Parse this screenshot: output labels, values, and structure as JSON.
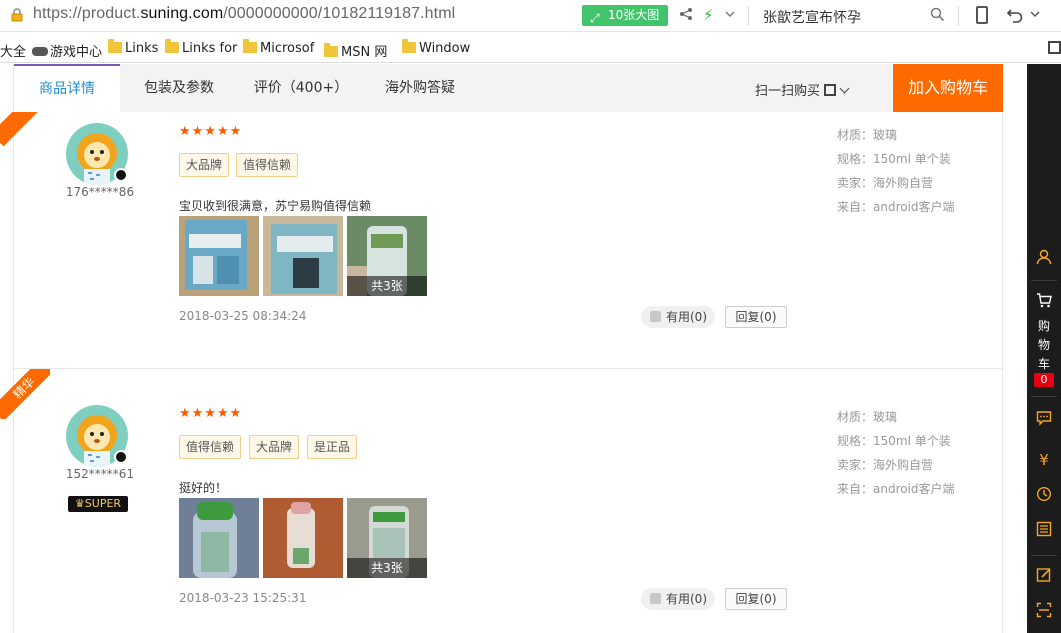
{
  "browser": {
    "url_prefix": "https://product.",
    "url_domain": "suning.com",
    "url_suffix": "/0000000000/10182119187.html",
    "image_button": "10张大图",
    "search_text": "张歆艺宣布怀孕"
  },
  "bookmarks": [
    {
      "label": "大全",
      "icon": "none"
    },
    {
      "label": "游戏中心",
      "icon": "gamepad-icon"
    },
    {
      "label": "Links",
      "icon": "folder-icon"
    },
    {
      "label": "Links for",
      "icon": "folder-icon"
    },
    {
      "label": "Microsof",
      "icon": "folder-icon"
    },
    {
      "label": "MSN 网",
      "icon": "folder-icon"
    },
    {
      "label": "Window",
      "icon": "folder-icon"
    }
  ],
  "tabs": {
    "details": "商品详情",
    "params": "包装及参数",
    "reviews": "评价（400+）",
    "overseas": "海外购答疑",
    "scan": "扫一扫购买",
    "add_cart": "加入购物车"
  },
  "reviews": [
    {
      "badge": "",
      "user": "176*****86",
      "stars": "★★★★★",
      "tags": [
        "大品牌",
        "值得信赖"
      ],
      "text": "宝贝收到很满意，苏宁易购值得信赖",
      "photo_count": "共3张",
      "date": "2018-03-25 08:34:24",
      "useful": "有用(0)",
      "reply": "回复(0)",
      "meta": [
        "材质：玻璃",
        "规格：150ml 单个装",
        "卖家：海外购自营",
        "来自：android客户端"
      ]
    },
    {
      "badge": "精华",
      "user": "152*****61",
      "level": "SUPER",
      "stars": "★★★★★",
      "tags": [
        "值得信赖",
        "大品牌",
        "是正品"
      ],
      "text": "挺好的！",
      "photo_count": "共3张",
      "date": "2018-03-23 15:25:31",
      "useful": "有用(0)",
      "reply": "回复(0)",
      "meta": [
        "材质：玻璃",
        "规格：150ml 单个装",
        "卖家：海外购自营",
        "来自：android客户端"
      ]
    }
  ],
  "sidebar": {
    "cart_label": [
      "购",
      "物",
      "车"
    ],
    "cart_count": "0"
  }
}
